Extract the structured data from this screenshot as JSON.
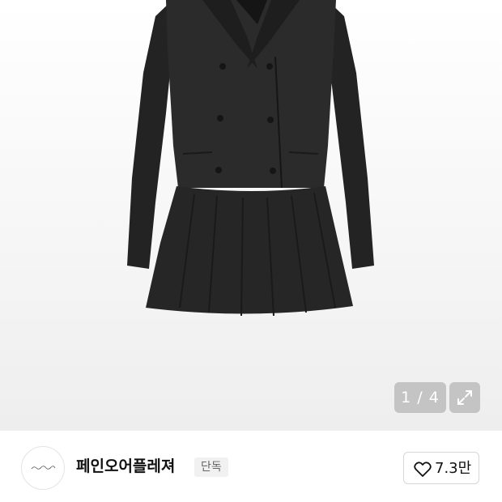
{
  "gallery": {
    "counter": "1 / 4",
    "current_index": 1,
    "total_images": 4,
    "expand_icon": "expand-arrows-icon"
  },
  "brand": {
    "logo_text": "Pain ou plaisir",
    "name": "페인오어플레져",
    "badge": "단독",
    "like_icon": "heart-outline-icon",
    "like_count": "7.3만"
  },
  "colors": {
    "garment": "#2b2b2b",
    "overlay": "#a0a0a0",
    "badge_bg": "#f1f1f1"
  }
}
